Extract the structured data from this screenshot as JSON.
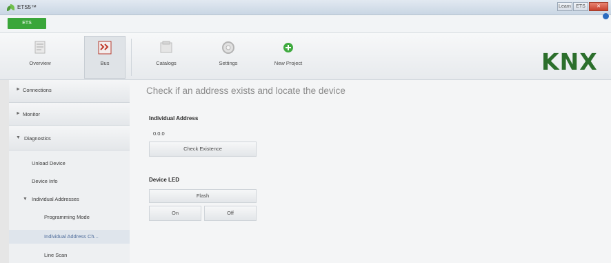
{
  "window": {
    "title": "ETS5™",
    "buttons": [
      "Learn",
      "ETS",
      "Close"
    ]
  },
  "ets_tab": {
    "label": "ETS"
  },
  "ribbon": {
    "items": [
      {
        "label": "Overview",
        "icon": "overview-icon"
      },
      {
        "label": "Bus",
        "icon": "bus-icon",
        "selected": true
      },
      {
        "label": "Catalogs",
        "icon": "catalogs-icon"
      },
      {
        "label": "Settings",
        "icon": "settings-icon"
      },
      {
        "label": "New Project",
        "icon": "new-project-icon"
      }
    ],
    "logo": "KNX"
  },
  "sidebar": {
    "sections": [
      {
        "label": "Connections",
        "expanded": false
      },
      {
        "label": "Monitor",
        "expanded": false
      },
      {
        "label": "Diagnostics",
        "expanded": true
      }
    ],
    "items": [
      {
        "label": "Unload Device"
      },
      {
        "label": "Device Info"
      },
      {
        "label": "Individual Addresses",
        "expanded": true
      },
      {
        "label": "Programming Mode"
      },
      {
        "label": "Individual Address Ch...",
        "selected": true
      },
      {
        "label": "Line Scan"
      }
    ]
  },
  "main": {
    "title": "Check if an address exists and locate the device",
    "individual_address": {
      "label": "Individual Address",
      "value": "0.0.0",
      "check_button": "Check Existence"
    },
    "device_led": {
      "label": "Device LED",
      "flash_button": "Flash",
      "on_button": "On",
      "off_button": "Off"
    }
  },
  "colors": {
    "accent_green": "#3aa63a",
    "knx_green": "#2c6f2c",
    "title_gray": "#8a8a8a"
  }
}
